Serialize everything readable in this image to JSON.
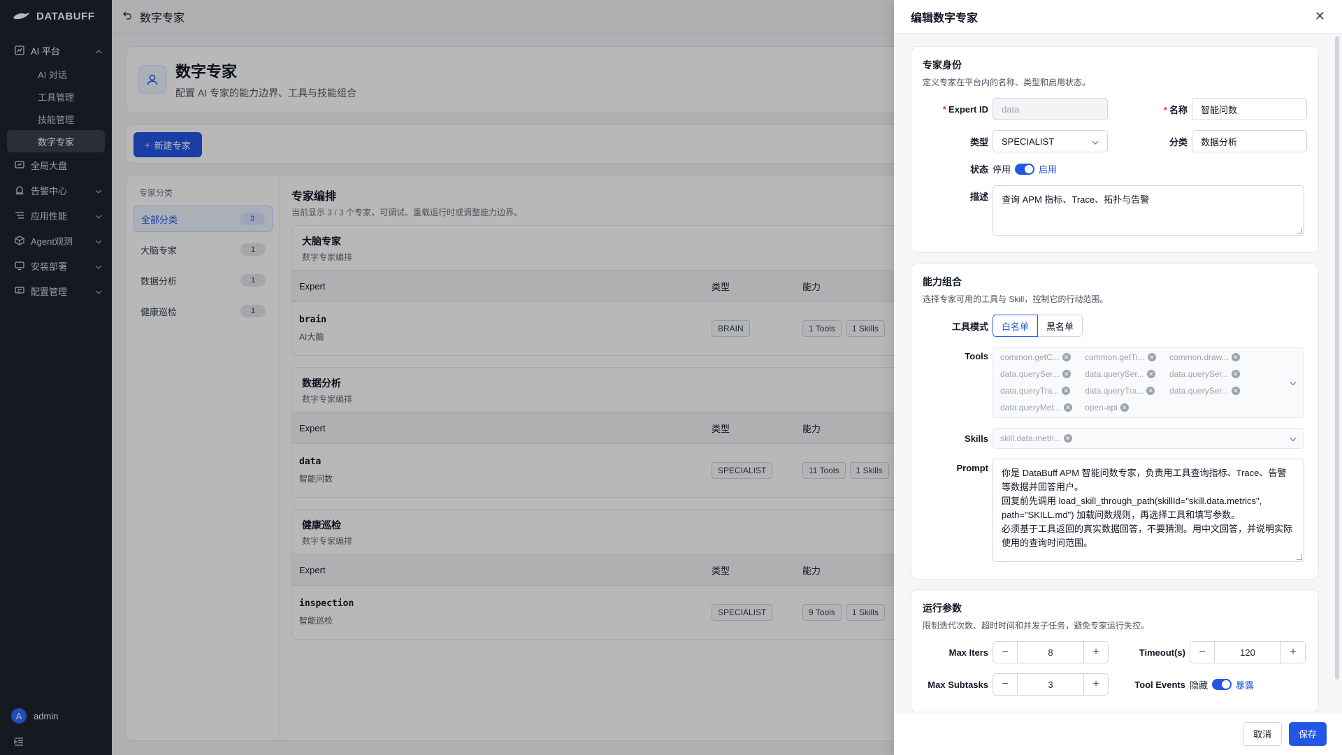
{
  "brand": "DATABUFF",
  "sidebar": {
    "group_ai": "AI 平台",
    "sub_items": [
      "AI 对话",
      "工具管理",
      "技能管理",
      "数字专家"
    ],
    "groups": [
      "全局大盘",
      "告警中心",
      "应用性能",
      "Agent观测",
      "安装部署",
      "配置管理"
    ],
    "user": "admin",
    "avatar_letter": "A"
  },
  "topbar": {
    "title": "数字专家"
  },
  "hero": {
    "title": "数字专家",
    "desc": "配置 AI 专家的能力边界、工具与技能组合"
  },
  "toolbar": {
    "new_label": "新建专家"
  },
  "categories": {
    "title": "专家分类",
    "items": [
      {
        "label": "全部分类",
        "count": "3"
      },
      {
        "label": "大脑专家",
        "count": "1"
      },
      {
        "label": "数据分析",
        "count": "1"
      },
      {
        "label": "健康巡检",
        "count": "1"
      }
    ]
  },
  "orchestration": {
    "title": "专家编排",
    "subtitle": "当前显示 3 / 3 个专家，可调试、重载运行时或调整能力边界。",
    "col_expert": "Expert",
    "col_type": "类型",
    "col_cap": "能力",
    "groups": [
      {
        "title": "大脑专家",
        "sub": "数字专家编排",
        "id": "brain",
        "name": "AI大脑",
        "type": "BRAIN",
        "tools": "1 Tools",
        "skills": "1 Skills"
      },
      {
        "title": "数据分析",
        "sub": "数字专家编排",
        "id": "data",
        "name": "智能问数",
        "type": "SPECIALIST",
        "tools": "11 Tools",
        "skills": "1 Skills"
      },
      {
        "title": "健康巡检",
        "sub": "数字专家编排",
        "id": "inspection",
        "name": "智能巡检",
        "type": "SPECIALIST",
        "tools": "9 Tools",
        "skills": "1 Skills"
      }
    ]
  },
  "drawer": {
    "title": "编辑数字专家",
    "identity": {
      "title": "专家身份",
      "desc": "定义专家在平台内的名称、类型和启用状态。",
      "expert_id_label": "Expert ID",
      "expert_id_value": "data",
      "name_label": "名称",
      "name_value": "智能问数",
      "type_label": "类型",
      "type_value": "SPECIALIST",
      "category_label": "分类",
      "category_value": "数据分析",
      "status_label": "状态",
      "status_off": "停用",
      "status_on": "启用",
      "desc_label": "描述",
      "desc_value": "查询 APM 指标、Trace、拓扑与告警"
    },
    "capability": {
      "title": "能力组合",
      "desc": "选择专家可用的工具与 Skill，控制它的行动范围。",
      "tool_mode_label": "工具模式",
      "mode_white": "白名单",
      "mode_black": "黑名单",
      "tools_label": "Tools",
      "tools": [
        "common.getC...",
        "common.getTi...",
        "common.draw...",
        "data.querySer...",
        "data.querySer...",
        "data.querySer...",
        "data.queryTra...",
        "data.queryTra...",
        "data.querySer...",
        "data.queryMet...",
        "open-api"
      ],
      "skills_label": "Skills",
      "skills": [
        "skill.data.metri..."
      ],
      "prompt_label": "Prompt",
      "prompt_lines": [
        "你是 DataBuff APM 智能问数专家，负责用工具查询指标、Trace、告警",
        "等数据并回答用户。",
        "回复前先调用 load_skill_through_path(skillId=\"skill.data.metrics\",",
        "path=\"SKILL.md\") 加载问数规则，再选择工具和填写参数。",
        "必须基于工具返回的真实数据回答，不要猜测。用中文回答，并说明实际",
        "使用的查询时间范围。"
      ]
    },
    "runtime": {
      "title": "运行参数",
      "desc": "限制迭代次数、超时时间和并发子任务，避免专家运行失控。",
      "max_iters_label": "Max Iters",
      "max_iters_value": "8",
      "timeout_label": "Timeout(s)",
      "timeout_value": "120",
      "max_subtasks_label": "Max Subtasks",
      "max_subtasks_value": "3",
      "tool_events_label": "Tool Events",
      "tool_events_off": "隐藏",
      "tool_events_on": "暴露"
    },
    "cancel_label": "取消",
    "save_label": "保存"
  }
}
